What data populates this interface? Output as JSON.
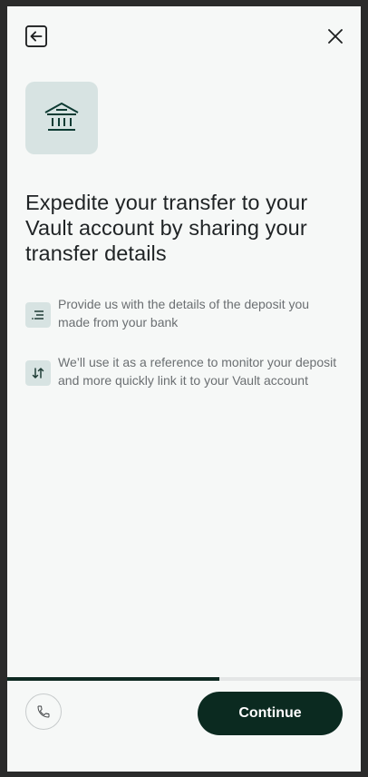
{
  "header": {
    "back_icon": "arrow-left-icon",
    "close_icon": "close-icon"
  },
  "hero": {
    "icon": "bank-icon",
    "accent": "#0e3b33",
    "background": "#d7e3e2"
  },
  "title": "Expedite your transfer to your Vault account by sharing your transfer details",
  "steps": [
    {
      "icon": "list-icon",
      "text": "Provide us with the details of the deposit you made from your bank"
    },
    {
      "icon": "swap-vertical-icon",
      "text": "We’ll use it as a reference to monitor your deposit and more quickly link it to your Vault account"
    }
  ],
  "progress": {
    "fraction": 0.6
  },
  "footer": {
    "phone_icon": "phone-icon",
    "continue_label": "Continue"
  },
  "colors": {
    "primary": "#0b2a20",
    "panel_bg": "#f6f8f7",
    "muted_text": "#6b6f72"
  }
}
